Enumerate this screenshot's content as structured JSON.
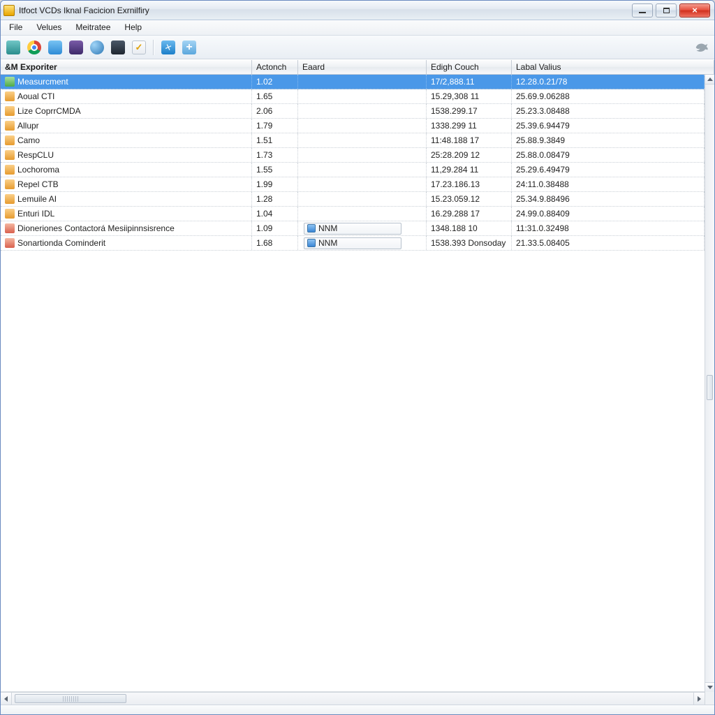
{
  "window": {
    "title": "Itfoct VCDs Iknal Facicion Exrnilfiry"
  },
  "menu": {
    "items": [
      "File",
      "Velues",
      "Meitratee",
      "Help"
    ]
  },
  "toolbar": {
    "icons": [
      "teal-box-icon",
      "chrome-icon",
      "sky-box-icon",
      "purple-box-icon",
      "globe-gear-icon",
      "dark-panel-icon",
      "checkbox-icon",
      "bird-blue-icon",
      "plus-icon"
    ],
    "right_icon": "bird-gray-icon"
  },
  "columns": {
    "c0": "&M Exporiter",
    "c1": "Actonch",
    "c2": "Eaard",
    "c3": "Edigh Couch",
    "c4": "Labal Valius"
  },
  "rows": [
    {
      "icon": "ri0",
      "name": "Measurcment",
      "action": "1.02",
      "e": "",
      "edge": "17/2,888.11",
      "label": "12.28.0.21/78",
      "selected": true
    },
    {
      "icon": "ri1",
      "name": "Aoual CTI",
      "action": "1.65",
      "e": "",
      "edge": "15.29,308 11",
      "label": "25.69.9.06288",
      "selected": false
    },
    {
      "icon": "ri1",
      "name": "Lize CoprrCMDA",
      "action": "2.06",
      "e": "",
      "edge": "1538.299.17",
      "label": "25.23.3.08488",
      "selected": false
    },
    {
      "icon": "ri1",
      "name": "Allupr",
      "action": "1.79",
      "e": "",
      "edge": "1338.299 11",
      "label": "25.39.6.94479",
      "selected": false
    },
    {
      "icon": "ri1",
      "name": "Camo",
      "action": "1.51",
      "e": "",
      "edge": "11:48.188 17",
      "label": "25.88.9.3849",
      "selected": false
    },
    {
      "icon": "ri1",
      "name": "RespCLU",
      "action": "1.73",
      "e": "",
      "edge": "25:28.209 12",
      "label": "25.88.0.08479",
      "selected": false
    },
    {
      "icon": "ri1",
      "name": "Lochoroma",
      "action": "1.55",
      "e": "",
      "edge": "11,29.284 11",
      "label": "25.29.6.49479",
      "selected": false
    },
    {
      "icon": "ri1",
      "name": "Repel CTB",
      "action": "1.99",
      "e": "",
      "edge": "17.23.186.13",
      "label": "24:11.0.38488",
      "selected": false
    },
    {
      "icon": "ri1",
      "name": "Lemuile AI",
      "action": "1.28",
      "e": "",
      "edge": "15.23.059.12",
      "label": "25.34.9.88496",
      "selected": false
    },
    {
      "icon": "ri1",
      "name": "Enturi IDL",
      "action": "1.04",
      "e": "",
      "edge": "16.29.288 17",
      "label": "24.99.0.88409",
      "selected": false
    },
    {
      "icon": "ri2",
      "name": "Dioneriones Contactorá Mesiipinnsisrence",
      "action": "1.09",
      "e": "NNM",
      "edge": "1348.188 10",
      "label": "11:31.0.32498",
      "selected": false
    },
    {
      "icon": "ri2",
      "name": "Sonartionda Cominderit",
      "action": "1.68",
      "e": "NNM",
      "edge": "1538.393 Donsoday",
      "label": "21.33.5.08405",
      "selected": false
    }
  ]
}
